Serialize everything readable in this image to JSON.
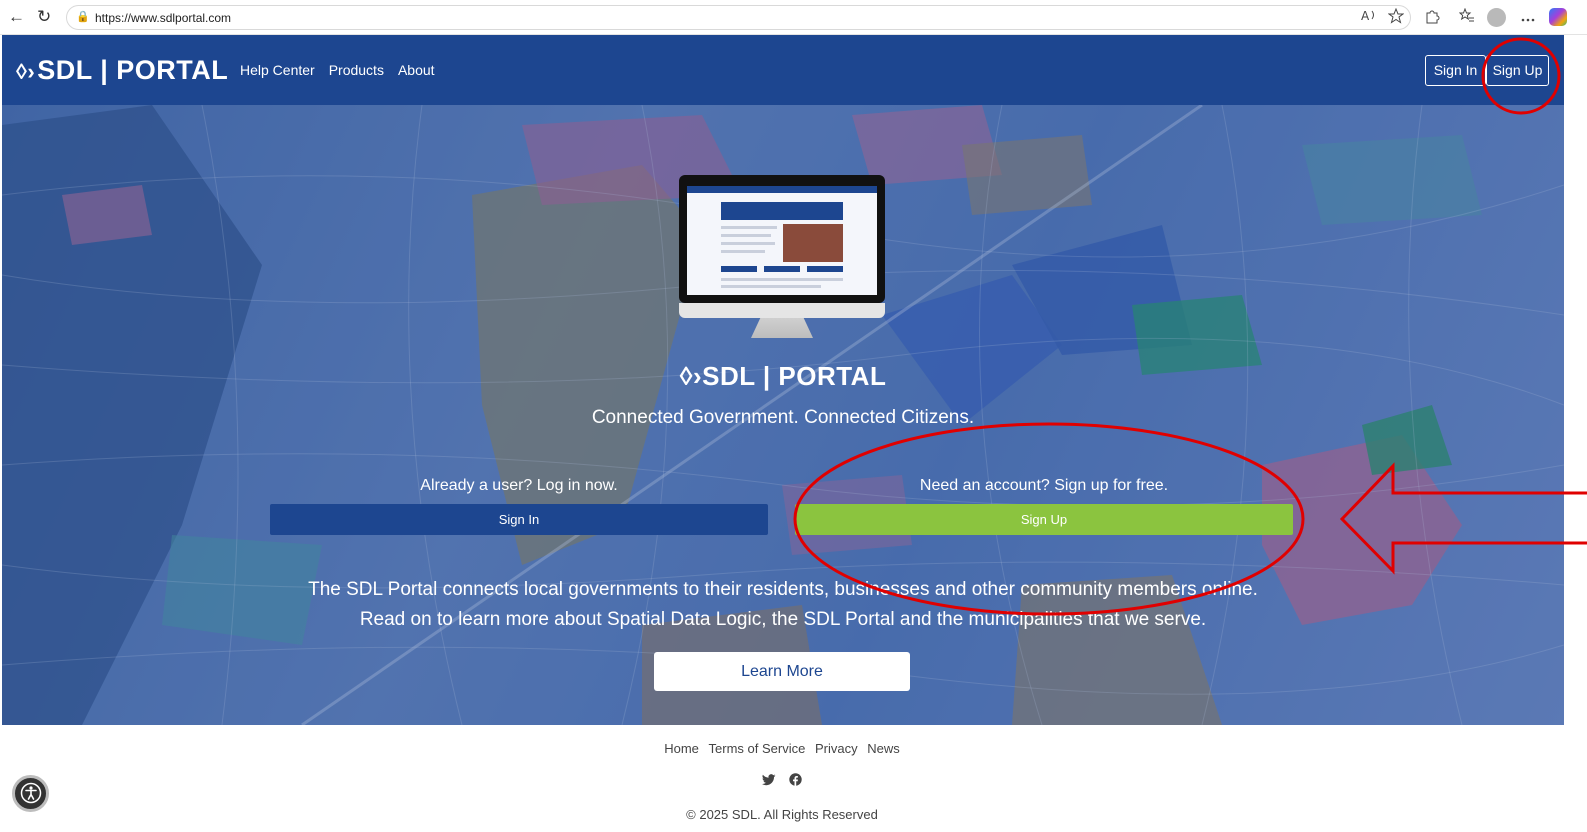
{
  "browser": {
    "url": "https://www.sdlportal.com",
    "back_icon": "←",
    "refresh_icon": "↻",
    "lock_icon": "🔒"
  },
  "header": {
    "logo_mark": "◊›",
    "logo_text": "SDL | PORTAL",
    "nav": [
      "Help Center",
      "Products",
      "About"
    ],
    "sign_in": "Sign In",
    "sign_up": "Sign Up"
  },
  "hero": {
    "logo_mark": "◊›",
    "logo_text": "SDL | PORTAL",
    "tagline": "Connected Government. Connected Citizens.",
    "login_hint": "Already a user? Log in now.",
    "signup_hint": "Need an account? Sign up for free.",
    "sign_in_button": "Sign In",
    "sign_up_button": "Sign Up",
    "description_line1": "The SDL Portal connects local governments to their residents, businesses and other community members online.",
    "description_line2": "Read on to learn more about Spatial Data Logic, the SDL Portal and the municipalities that we serve.",
    "learn_more": "Learn More"
  },
  "footer": {
    "links": [
      "Home",
      "Terms of Service",
      "Privacy",
      "News"
    ],
    "social": [
      "twitter-icon",
      "facebook-icon"
    ],
    "copyright": "© 2025 SDL. All Rights Reserved"
  },
  "colors": {
    "brand_blue": "#1d4690",
    "signup_green": "#8bc43f",
    "annotation_red": "#e00000"
  }
}
